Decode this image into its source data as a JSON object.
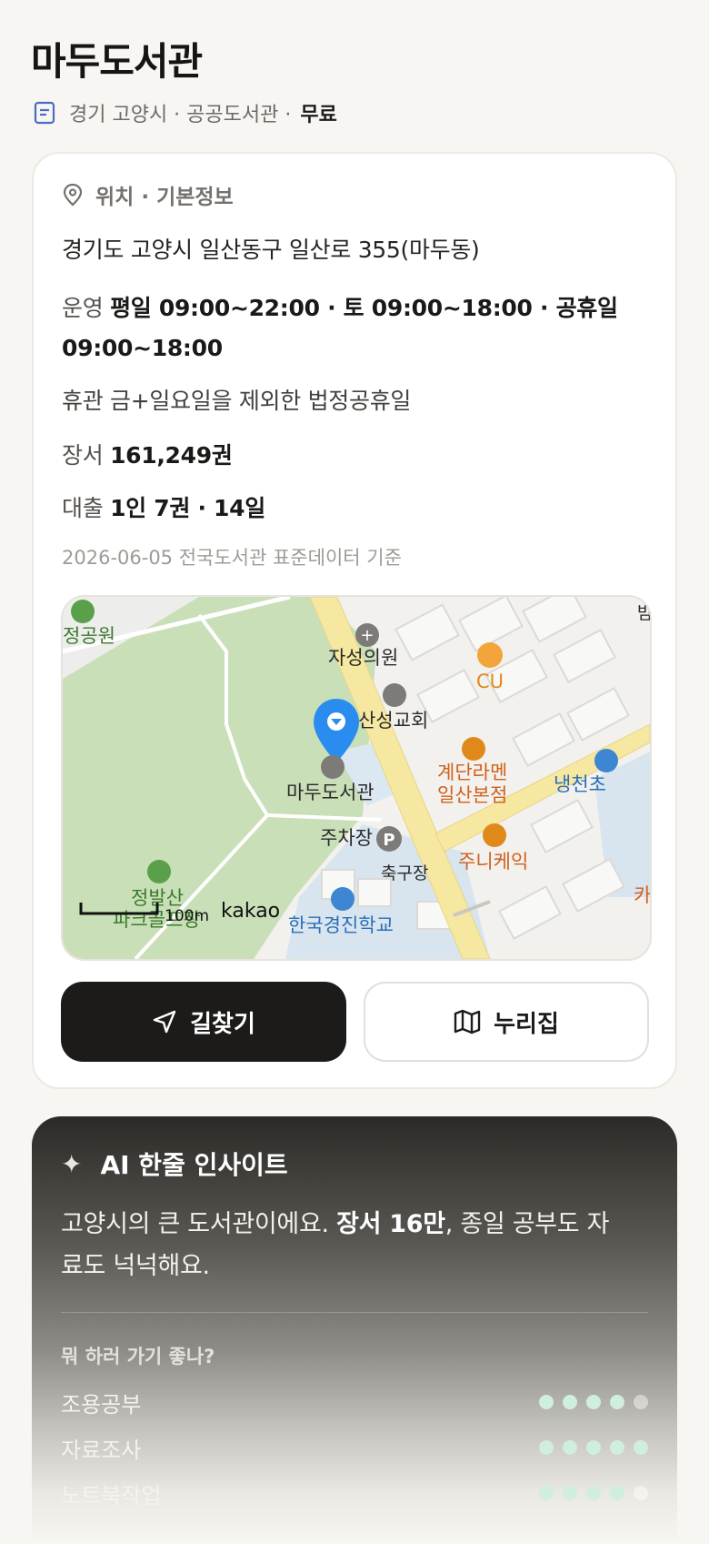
{
  "header": {
    "title": "마두도서관",
    "location": "경기 고양시 · 공공도서관 ·",
    "fee": "무료"
  },
  "info": {
    "section_title": "위치 · 기본정보",
    "address": "경기도 고양시 일산동구 일산로 355(마두동)",
    "hours_label": "운영",
    "hours_value": "평일 09:00~22:00 · 토 09:00~18:00 · 공휴일 09:00~18:00",
    "closed": "휴관 금+일요일을 제외한 법정공휴일",
    "books_label": "장서",
    "books_value": "161,249권",
    "loan_label": "대출",
    "loan_value": "1인 7권 · 14일",
    "data_source": "2026-06-05 전국도서관 표준데이터 기준"
  },
  "map": {
    "labels": {
      "park": "정공원",
      "clinic": "자성의원",
      "cu": "CU",
      "church": "산성교회",
      "library": "마두도서관",
      "ramen1": "계단라멘",
      "ramen2": "일산본점",
      "school_right": "냉천초",
      "parking": "주차장",
      "cafe": "주니케익",
      "soccer": "축구장",
      "golf1": "정발산",
      "golf2": "파크골프장",
      "school": "한국경진학교",
      "scale": "100m",
      "brand": "kakao",
      "edge_top": "밤",
      "edge_right": "카"
    }
  },
  "actions": {
    "directions": "길찾기",
    "website": "누리집"
  },
  "ai": {
    "title": "AI 한줄 인사이트",
    "text_before": "고양시의 큰 도서관이에요. ",
    "text_bold": "장서 16만",
    "text_after": ", 종일 공부도 자료도 넉넉해요.",
    "question": "뭐 하러 가기 좋나?",
    "ratings": [
      {
        "name": "조용공부",
        "score": 4,
        "max": 5
      },
      {
        "name": "자료조사",
        "score": 5,
        "max": 5
      },
      {
        "name": "노트북작업",
        "score": 4,
        "max": 5
      }
    ]
  },
  "colors": {
    "accent_dark": "#1c1b19",
    "pin_blue": "#2b8cf0",
    "rating_on": "#cfeee0",
    "map_park": "#c9dfb8",
    "map_road": "#f6e7a1"
  }
}
